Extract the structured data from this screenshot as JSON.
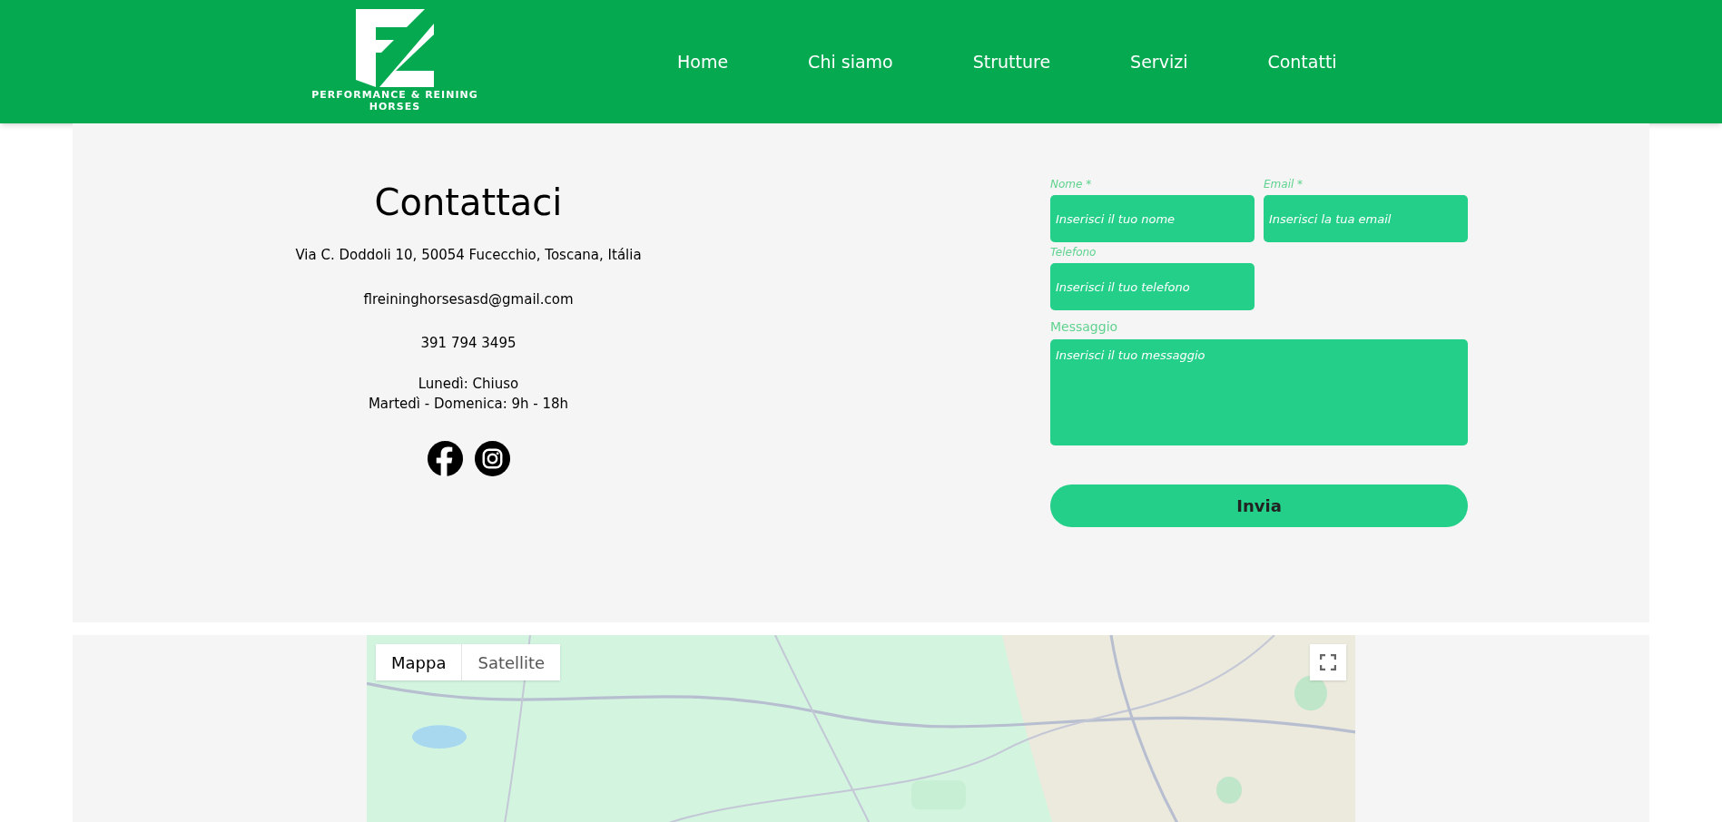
{
  "header": {
    "logo": {
      "lines": [
        "PERFORMANCE & REINING",
        "HORSES"
      ]
    },
    "nav": [
      {
        "label": "Home"
      },
      {
        "label": "Chi siamo"
      },
      {
        "label": "Strutture"
      },
      {
        "label": "Servizi"
      },
      {
        "label": "Contatti"
      }
    ]
  },
  "contact": {
    "title": "Contattaci",
    "address": "Via C. Doddoli 10, 50054 Fucecchio, Toscana, Itália",
    "email": "flreininghorsesasd@gmail.com",
    "phone": "391 794 3495",
    "hours": [
      "Lunedì: Chiuso",
      "Martedì - Domenica: 9h - 18h"
    ],
    "social": [
      {
        "kind": "facebook"
      },
      {
        "kind": "instagram"
      }
    ]
  },
  "form": {
    "fields": [
      {
        "label": "Nome *",
        "placeholder": "Inserisci il tuo nome",
        "kind": "input"
      },
      {
        "label": "Email *",
        "placeholder": "Inserisci la tua email",
        "kind": "input"
      },
      {
        "label": "Telefono",
        "placeholder": "Inserisci il tuo telefono",
        "kind": "input"
      },
      {
        "label": "Messaggio",
        "placeholder": "Inserisci il tuo messaggio",
        "kind": "textarea"
      }
    ],
    "submit": "Invia"
  },
  "map": {
    "kind": "picture",
    "map_types": [
      {
        "label": "Mappa",
        "selected": true
      },
      {
        "label": "Satellite",
        "selected": false
      }
    ]
  }
}
